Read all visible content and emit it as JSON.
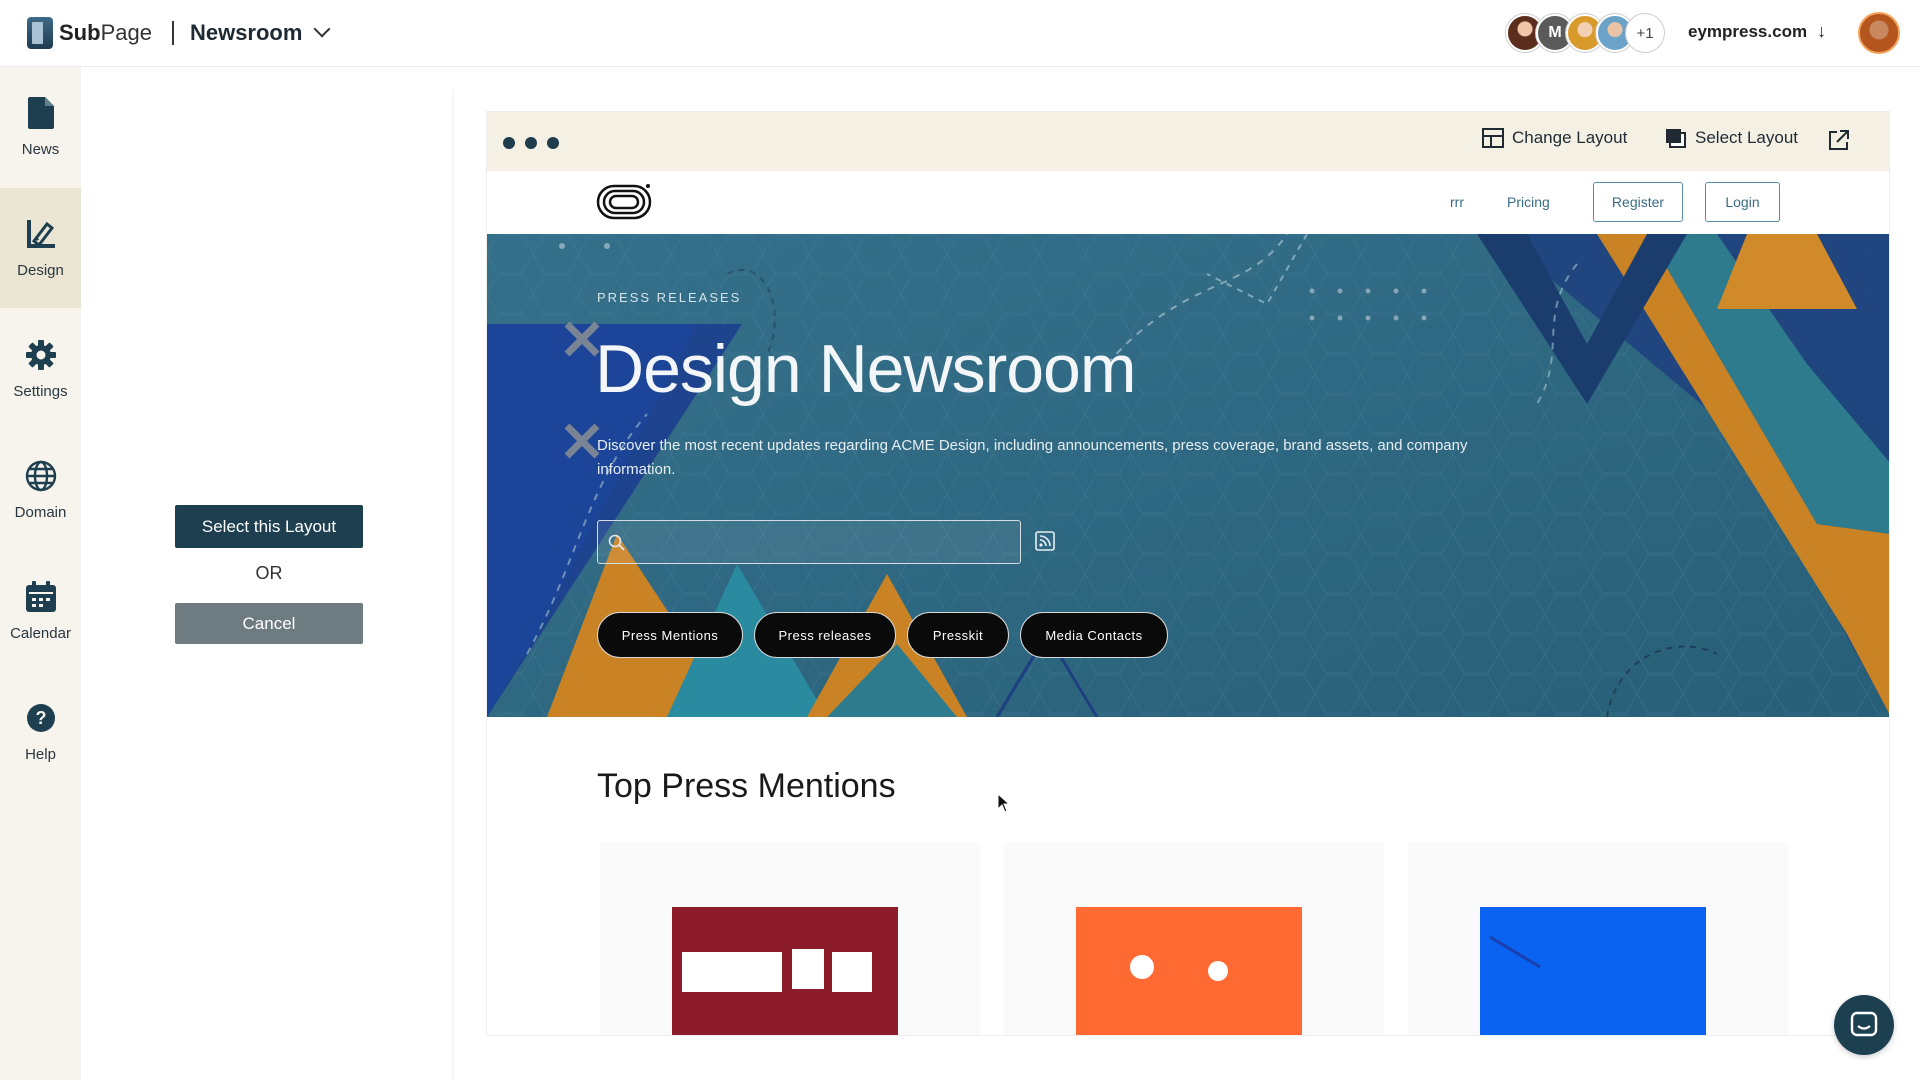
{
  "app": {
    "brand_prefix": "Sub",
    "brand_suffix": "Page",
    "site_name": "Newsroom",
    "domain": "eympress.com",
    "collaborators": {
      "initial": "M",
      "extra_count": "+1"
    }
  },
  "sidebar": {
    "items": [
      {
        "label": "News",
        "icon": "document-icon"
      },
      {
        "label": "Design",
        "icon": "design-pencil-icon",
        "active": true
      },
      {
        "label": "Settings",
        "icon": "gear-icon"
      },
      {
        "label": "Domain",
        "icon": "globe-icon"
      },
      {
        "label": "Calendar",
        "icon": "calendar-icon"
      },
      {
        "label": "Help",
        "icon": "help-icon"
      }
    ]
  },
  "layout_panel": {
    "select_label": "Select this Layout",
    "or_label": "OR",
    "cancel_label": "Cancel"
  },
  "preview": {
    "change_layout_label": "Change Layout",
    "select_layout_label": "Select Layout",
    "site_nav": {
      "links": [
        "rrr",
        "Pricing"
      ],
      "register_label": "Register",
      "login_label": "Login"
    },
    "hero": {
      "eyebrow": "PRESS RELEASES",
      "title": "Design Newsroom",
      "description": "Discover the most recent updates regarding ACME Design, including announcements, press coverage, brand assets, and company information.",
      "search_value": "",
      "pills": [
        "Press Mentions",
        "Press releases",
        "Presskit",
        "Media Contacts"
      ]
    },
    "section_title": "Top Press Mentions"
  },
  "colors": {
    "primary_dark": "#1d3f4f",
    "rail_bg": "#f6f4ec",
    "rail_active": "#ebe6d4",
    "preview_bar": "#f4f1e4",
    "hero_teal": "#2e6b86",
    "accent_orange": "#d08a2a",
    "card_red": "#8c1c2a",
    "card_orange": "#ff6a33",
    "card_blue": "#0a62f0"
  }
}
